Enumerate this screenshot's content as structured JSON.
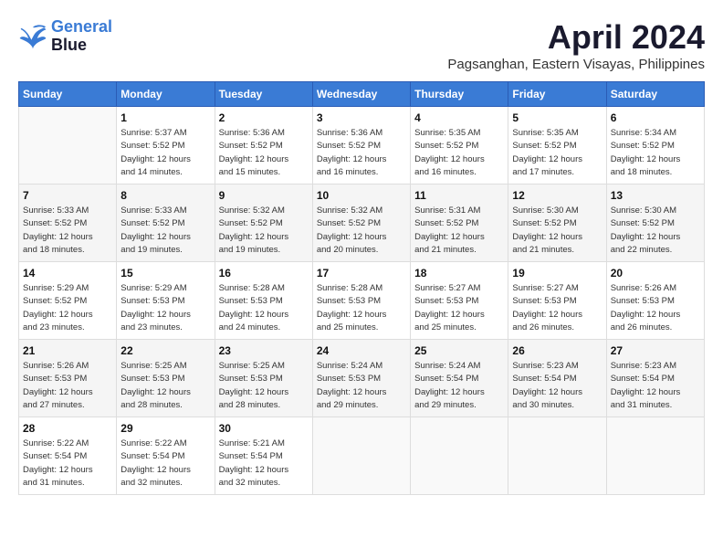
{
  "header": {
    "logo_line1": "General",
    "logo_line2": "Blue",
    "month": "April 2024",
    "location": "Pagsanghan, Eastern Visayas, Philippines"
  },
  "weekdays": [
    "Sunday",
    "Monday",
    "Tuesday",
    "Wednesday",
    "Thursday",
    "Friday",
    "Saturday"
  ],
  "weeks": [
    [
      null,
      {
        "day": 1,
        "sunrise": "5:37 AM",
        "sunset": "5:52 PM",
        "daylight": "12 hours and 14 minutes."
      },
      {
        "day": 2,
        "sunrise": "5:36 AM",
        "sunset": "5:52 PM",
        "daylight": "12 hours and 15 minutes."
      },
      {
        "day": 3,
        "sunrise": "5:36 AM",
        "sunset": "5:52 PM",
        "daylight": "12 hours and 16 minutes."
      },
      {
        "day": 4,
        "sunrise": "5:35 AM",
        "sunset": "5:52 PM",
        "daylight": "12 hours and 16 minutes."
      },
      {
        "day": 5,
        "sunrise": "5:35 AM",
        "sunset": "5:52 PM",
        "daylight": "12 hours and 17 minutes."
      },
      {
        "day": 6,
        "sunrise": "5:34 AM",
        "sunset": "5:52 PM",
        "daylight": "12 hours and 18 minutes."
      }
    ],
    [
      {
        "day": 7,
        "sunrise": "5:33 AM",
        "sunset": "5:52 PM",
        "daylight": "12 hours and 18 minutes."
      },
      {
        "day": 8,
        "sunrise": "5:33 AM",
        "sunset": "5:52 PM",
        "daylight": "12 hours and 19 minutes."
      },
      {
        "day": 9,
        "sunrise": "5:32 AM",
        "sunset": "5:52 PM",
        "daylight": "12 hours and 19 minutes."
      },
      {
        "day": 10,
        "sunrise": "5:32 AM",
        "sunset": "5:52 PM",
        "daylight": "12 hours and 20 minutes."
      },
      {
        "day": 11,
        "sunrise": "5:31 AM",
        "sunset": "5:52 PM",
        "daylight": "12 hours and 21 minutes."
      },
      {
        "day": 12,
        "sunrise": "5:30 AM",
        "sunset": "5:52 PM",
        "daylight": "12 hours and 21 minutes."
      },
      {
        "day": 13,
        "sunrise": "5:30 AM",
        "sunset": "5:52 PM",
        "daylight": "12 hours and 22 minutes."
      }
    ],
    [
      {
        "day": 14,
        "sunrise": "5:29 AM",
        "sunset": "5:52 PM",
        "daylight": "12 hours and 23 minutes."
      },
      {
        "day": 15,
        "sunrise": "5:29 AM",
        "sunset": "5:53 PM",
        "daylight": "12 hours and 23 minutes."
      },
      {
        "day": 16,
        "sunrise": "5:28 AM",
        "sunset": "5:53 PM",
        "daylight": "12 hours and 24 minutes."
      },
      {
        "day": 17,
        "sunrise": "5:28 AM",
        "sunset": "5:53 PM",
        "daylight": "12 hours and 25 minutes."
      },
      {
        "day": 18,
        "sunrise": "5:27 AM",
        "sunset": "5:53 PM",
        "daylight": "12 hours and 25 minutes."
      },
      {
        "day": 19,
        "sunrise": "5:27 AM",
        "sunset": "5:53 PM",
        "daylight": "12 hours and 26 minutes."
      },
      {
        "day": 20,
        "sunrise": "5:26 AM",
        "sunset": "5:53 PM",
        "daylight": "12 hours and 26 minutes."
      }
    ],
    [
      {
        "day": 21,
        "sunrise": "5:26 AM",
        "sunset": "5:53 PM",
        "daylight": "12 hours and 27 minutes."
      },
      {
        "day": 22,
        "sunrise": "5:25 AM",
        "sunset": "5:53 PM",
        "daylight": "12 hours and 28 minutes."
      },
      {
        "day": 23,
        "sunrise": "5:25 AM",
        "sunset": "5:53 PM",
        "daylight": "12 hours and 28 minutes."
      },
      {
        "day": 24,
        "sunrise": "5:24 AM",
        "sunset": "5:53 PM",
        "daylight": "12 hours and 29 minutes."
      },
      {
        "day": 25,
        "sunrise": "5:24 AM",
        "sunset": "5:54 PM",
        "daylight": "12 hours and 29 minutes."
      },
      {
        "day": 26,
        "sunrise": "5:23 AM",
        "sunset": "5:54 PM",
        "daylight": "12 hours and 30 minutes."
      },
      {
        "day": 27,
        "sunrise": "5:23 AM",
        "sunset": "5:54 PM",
        "daylight": "12 hours and 31 minutes."
      }
    ],
    [
      {
        "day": 28,
        "sunrise": "5:22 AM",
        "sunset": "5:54 PM",
        "daylight": "12 hours and 31 minutes."
      },
      {
        "day": 29,
        "sunrise": "5:22 AM",
        "sunset": "5:54 PM",
        "daylight": "12 hours and 32 minutes."
      },
      {
        "day": 30,
        "sunrise": "5:21 AM",
        "sunset": "5:54 PM",
        "daylight": "12 hours and 32 minutes."
      },
      null,
      null,
      null,
      null
    ]
  ]
}
